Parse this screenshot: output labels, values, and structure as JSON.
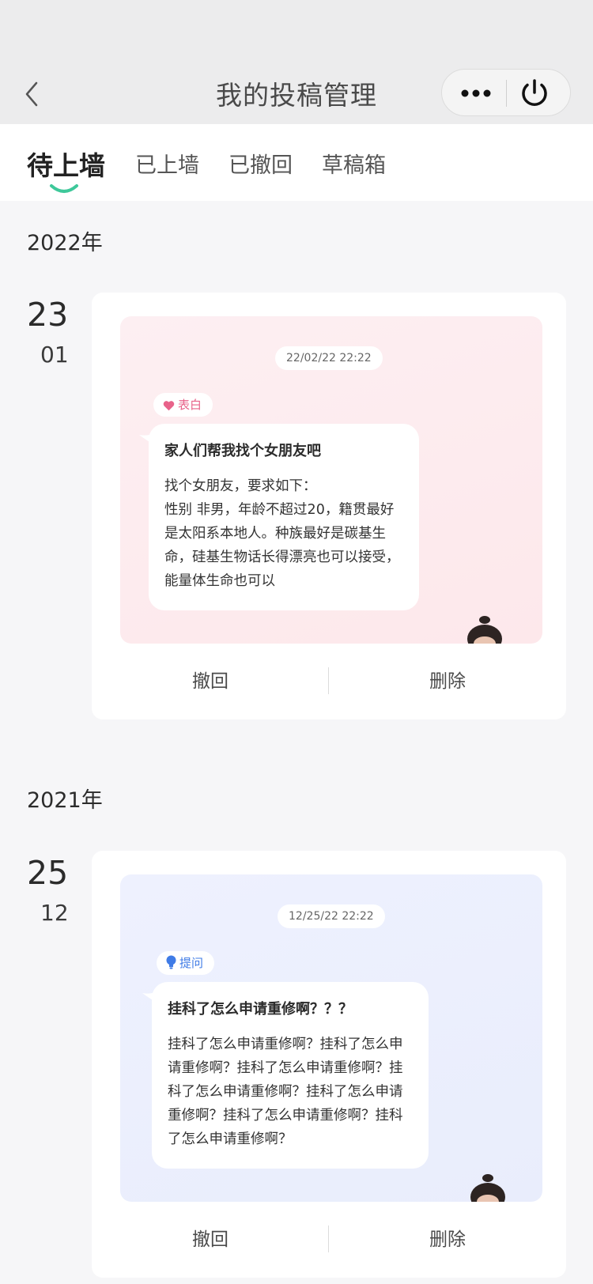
{
  "nav": {
    "title": "我的投稿管理"
  },
  "tabs": [
    {
      "label": "待上墙",
      "active": true
    },
    {
      "label": "已上墙",
      "active": false
    },
    {
      "label": "已撤回",
      "active": false
    },
    {
      "label": "草稿箱",
      "active": false
    }
  ],
  "groups": [
    {
      "year": "2022年",
      "post": {
        "day": "23",
        "month": "01",
        "timestamp": "22/02/22   22:22",
        "tag": "表白",
        "tag_color": "#e8638a",
        "title": "家人们帮我找个女朋友吧",
        "body": "找个女朋友，要求如下：\n性别 非男，年龄不超过20，籍贯最好是太阳系本地人。种族最好是碳基生命，硅基生物话长得漂亮也可以接受，能量体生命也可以",
        "withdraw_label": "撤回",
        "delete_label": "删除"
      }
    },
    {
      "year": "2021年",
      "post": {
        "day": "25",
        "month": "12",
        "timestamp": "12/25/22   22:22",
        "tag": "提问",
        "tag_color": "#3f7be6",
        "title": "挂科了怎么申请重修啊？？？",
        "body": "挂科了怎么申请重修啊？挂科了怎么申请重修啊？挂科了怎么申请重修啊？挂科了怎么申请重修啊？挂科了怎么申请重修啊？挂科了怎么申请重修啊？挂科了怎么申请重修啊？",
        "withdraw_label": "撤回",
        "delete_label": "删除"
      }
    }
  ],
  "colors": {
    "accent": "#3ec89a",
    "background": "#f6f6f8"
  }
}
